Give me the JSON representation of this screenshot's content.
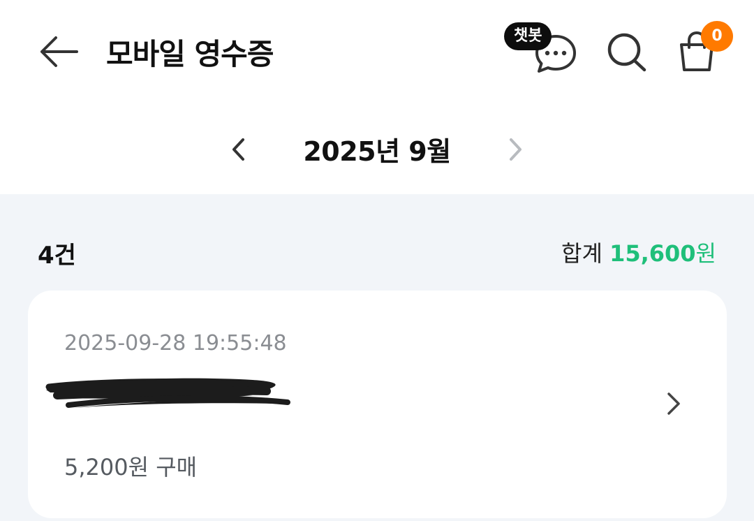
{
  "header": {
    "title": "모바일 영수증",
    "back_icon": "arrow-left-icon",
    "chat_badge": "챗봇",
    "chat_icon": "chat-bubble-icon",
    "search_icon": "search-icon",
    "cart_icon": "shopping-bag-icon",
    "cart_count": "0",
    "badge_color": "#ff7a00"
  },
  "month_nav": {
    "label": "2025년 9월",
    "prev_icon": "chevron-left-icon",
    "next_icon": "chevron-right-icon"
  },
  "summary": {
    "count": "4건",
    "total_label": "합계",
    "total_amount": "15,600",
    "total_unit": "원",
    "accent_color": "#1fbf7a"
  },
  "receipts": [
    {
      "datetime": "2025-09-28 19:55:48",
      "amount": "5,200원 구매"
    }
  ]
}
